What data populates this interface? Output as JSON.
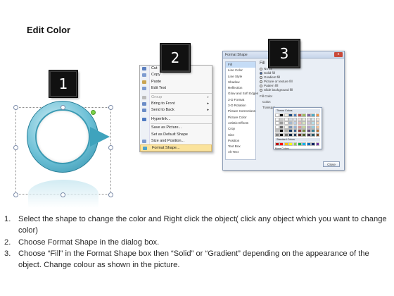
{
  "title": "Edit Color",
  "badges": [
    "1",
    "2",
    "3"
  ],
  "context_menu": {
    "items": [
      {
        "label": "Cut",
        "icon": "scissors-icon",
        "color": "#5b7fbf"
      },
      {
        "label": "Copy",
        "icon": "copy-icon",
        "color": "#7d9bd0"
      },
      {
        "label": "Paste",
        "icon": "paste-icon",
        "color": "#c9a452"
      },
      {
        "label": "Edit Text",
        "icon": "edit-text-icon",
        "color": "#7d9bd0"
      },
      {
        "label": "Group",
        "icon": "group-icon",
        "color": "#aaaaaa",
        "disabled": true
      },
      {
        "label": "Bring to Front",
        "icon": "bring-front-icon",
        "color": "#6b8cc7"
      },
      {
        "label": "Send to Back",
        "icon": "send-back-icon",
        "color": "#6b8cc7"
      },
      {
        "label": "Hyperlink...",
        "icon": "hyperlink-icon",
        "color": "#4f7ac2"
      },
      {
        "label": "Save as Picture...",
        "icon": "",
        "color": ""
      },
      {
        "label": "Set as Default Shape",
        "icon": "",
        "color": ""
      },
      {
        "label": "Size and Position...",
        "icon": "size-icon",
        "color": "#7d9bd0"
      },
      {
        "label": "Format Shape...",
        "icon": "format-shape-icon",
        "color": "#4fa3c8"
      }
    ]
  },
  "format_dialog": {
    "title": "Format Shape",
    "close_glyph": "x",
    "nav": [
      "Fill",
      "Line Color",
      "Line Style",
      "Shadow",
      "Reflection",
      "Glow and Soft Edges",
      "3-D Format",
      "3-D Rotation",
      "Picture Corrections",
      "Picture Color",
      "Artistic Effects",
      "Crop",
      "Size",
      "Position",
      "Text Box",
      "Alt Text"
    ],
    "section": "Fill",
    "options": [
      "No fill",
      "Solid fill",
      "Gradient fill",
      "Picture or texture fill",
      "Pattern fill",
      "Slide background fill"
    ],
    "fill_color_label": "Fill Color",
    "color_label": "Color:",
    "transparency_label": "Transpar",
    "close_button": "Close"
  },
  "palette": {
    "theme_label": "Theme Colors",
    "standard_label": "Standard Colors",
    "more_label": "More Colors...",
    "theme_row": [
      "#ffffff",
      "#000000",
      "#eeece1",
      "#1f497d",
      "#4f81bd",
      "#c0504d",
      "#9bbb59",
      "#8064a2",
      "#4bacc6",
      "#f79646"
    ],
    "standard_row": [
      "#c00000",
      "#ff0000",
      "#ffc000",
      "#ffff00",
      "#92d050",
      "#00b050",
      "#00b0f0",
      "#0070c0",
      "#002060",
      "#7030a0"
    ]
  },
  "steps": [
    {
      "num": "1.",
      "text": "Select the shape to change the color and Right click the object( click any object which you want to change color)"
    },
    {
      "num": "2.",
      "text": "Choose Format Shape in the dialog box."
    },
    {
      "num": "3.",
      "text": "Choose “Fill” in the Format Shape box then “Solid” or “Gradient” depending on the appearance of the object. Change colour as shown in the picture."
    }
  ]
}
